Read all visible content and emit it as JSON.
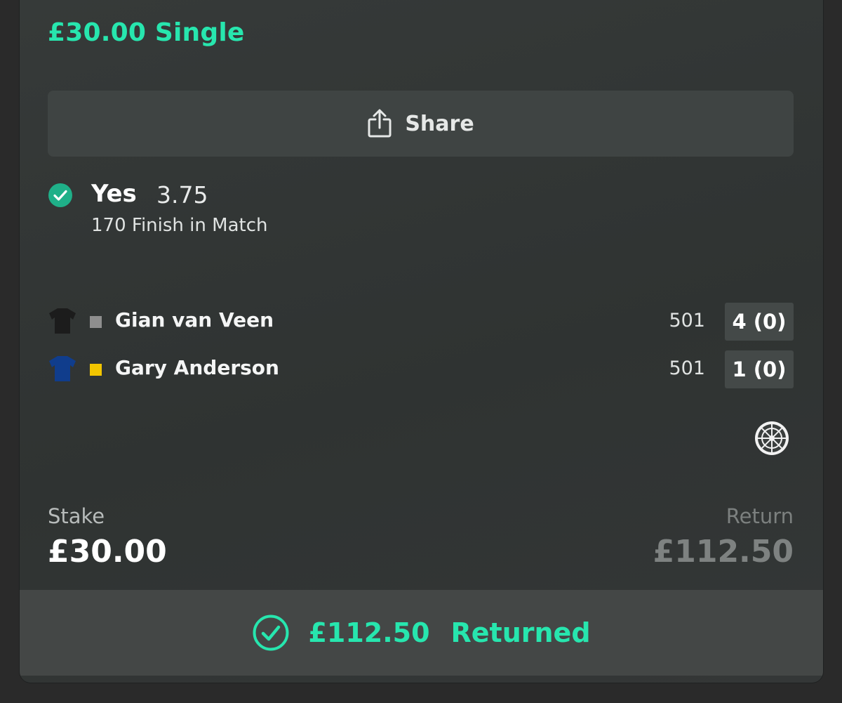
{
  "bet": {
    "title": "£30.00 Single"
  },
  "share": {
    "label": "Share",
    "icon": "share-icon"
  },
  "selection": {
    "status_icon": "check-circle-icon",
    "name": "Yes",
    "odds": "3.75",
    "market": "170 Finish in Match"
  },
  "players": [
    {
      "name": "Gian van Veen",
      "shirt_color": "#1c1c1c",
      "swatch_color": "#8e8e8e",
      "score": "501",
      "sets": "4 (0)"
    },
    {
      "name": "Gary Anderson",
      "shirt_color": "#103d8c",
      "swatch_color": "#f2c500",
      "score": "501",
      "sets": "1 (0)"
    }
  ],
  "dartboard_icon": "dartboard-icon",
  "stake": {
    "label": "Stake",
    "value": "£30.00"
  },
  "return": {
    "label": "Return",
    "value": "£112.50"
  },
  "returned": {
    "icon": "check-circle-icon",
    "amount": "£112.50",
    "text": "Returned"
  },
  "colors": {
    "accent": "#27e6ae",
    "card_bg": "#323635",
    "button_bg": "#3f4443"
  }
}
